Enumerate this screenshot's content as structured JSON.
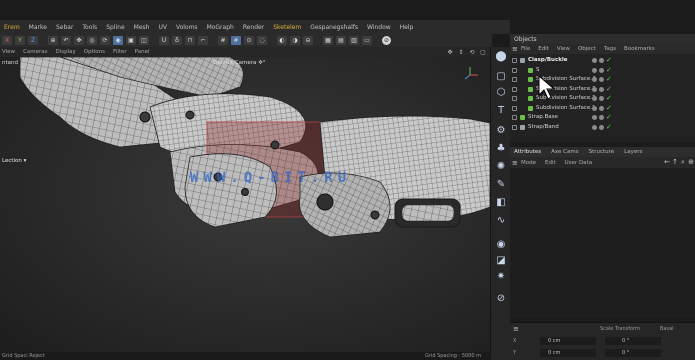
{
  "colors": {
    "accent": "#e4b13a",
    "menu_bg": "#2a2a2a",
    "panel_bg": "#222222",
    "object_green": "#6bbf4a",
    "check_green": "#59d14a",
    "watermark": "#2e64c8"
  },
  "menubar": {
    "items": [
      "Erem",
      "Marke",
      "Sebar",
      "Tools",
      "Spline",
      "Mesh",
      "UV",
      "Voloms",
      "MoGraph",
      "Render",
      "Sketelem",
      "Gespanegshalfs",
      "Window",
      "Help"
    ],
    "accent_indices": [
      0,
      10
    ]
  },
  "toolbar": {
    "icons": [
      {
        "name": "axis-x-lock-icon",
        "glyph": "X"
      },
      {
        "name": "axis-y-lock-icon",
        "glyph": "Y"
      },
      {
        "name": "axis-z-lock-icon",
        "glyph": "Z"
      },
      {
        "name": "coordinate-system-icon",
        "glyph": "⊕"
      },
      {
        "name": "undo-icon",
        "glyph": "↶"
      },
      {
        "name": "move-tool-icon",
        "glyph": "✥"
      },
      {
        "name": "scale-tool-icon",
        "glyph": "◎"
      },
      {
        "name": "rotate-tool-icon",
        "glyph": "⟳"
      },
      {
        "name": "live-selection-icon",
        "glyph": "◉"
      },
      {
        "name": "render-region-icon",
        "glyph": "▣"
      },
      {
        "name": "viewport-solo-icon",
        "glyph": "◫"
      },
      {
        "name": "magnet-icon",
        "glyph": "U"
      },
      {
        "name": "sculpt-icon",
        "glyph": "♁"
      },
      {
        "name": "quantize-icon",
        "glyph": "⊓"
      },
      {
        "name": "workplane-icon",
        "glyph": "⌐"
      },
      {
        "name": "grid-snap-icon",
        "glyph": "#"
      },
      {
        "name": "grid-snap-active-icon",
        "glyph": "#"
      },
      {
        "name": "snap-settings-icon",
        "glyph": "⊙"
      },
      {
        "name": "soft-selection-icon",
        "glyph": "◌"
      },
      {
        "name": "render-view-icon",
        "glyph": "◐"
      },
      {
        "name": "render-picture-viewer-icon",
        "glyph": "◑"
      },
      {
        "name": "render-settings-icon",
        "glyph": "⊖"
      },
      {
        "name": "clapper-icon",
        "glyph": "▦"
      },
      {
        "name": "film-icon",
        "glyph": "▤"
      },
      {
        "name": "render-queue-icon",
        "glyph": "▥"
      },
      {
        "name": "layout-icon",
        "glyph": "▭"
      },
      {
        "name": "help-icon",
        "glyph": "⊘"
      }
    ]
  },
  "viewport": {
    "menu": [
      "View",
      "Cameras",
      "Display",
      "Options",
      "Filter",
      "Panel"
    ],
    "mode_label": "ntand",
    "camera_label": "Default Camera ✲°",
    "object_label": "Lection  ▾",
    "status_left": "Grid Spaci Reject",
    "status_right": "Grid Spacing : 5000 m"
  },
  "object_manager": {
    "title": "Objects",
    "menu": [
      "File",
      "Edit",
      "View",
      "Object",
      "Tags",
      "Bookmarks"
    ],
    "rows": [
      {
        "indent": 0,
        "name": "Clasp/Buckle",
        "kind": "null",
        "head": true
      },
      {
        "indent": 1,
        "name": "S",
        "kind": "mesh"
      },
      {
        "indent": 1,
        "name": "Subdivision Surface.4",
        "kind": "mesh"
      },
      {
        "indent": 1,
        "name": "Subdivision Surface.2",
        "kind": "mesh"
      },
      {
        "indent": 1,
        "name": "Subdivision Surface.2",
        "kind": "mesh"
      },
      {
        "indent": 1,
        "name": "Subdivision Surface.1",
        "kind": "mesh"
      },
      {
        "indent": 0,
        "name": "Strap.Base",
        "kind": "mesh"
      },
      {
        "indent": 0,
        "name": "Strap/Band",
        "kind": "null"
      }
    ]
  },
  "attributes": {
    "tabs": [
      "Attributes",
      "Axe Cams",
      "Structure",
      "Layers"
    ],
    "active_tab": "Attributes",
    "menu": [
      "Mode",
      "Edit",
      "User Data"
    ]
  },
  "coordinates": {
    "headers": [
      "Scale Transform",
      "Basal"
    ],
    "rows": [
      {
        "label": "X",
        "pos": "0 cm",
        "rot": "0 °"
      },
      {
        "label": "Y",
        "pos": "0 cm",
        "rot": "0 °"
      }
    ]
  },
  "watermark_text": "WWW.Q-BIT.RU"
}
